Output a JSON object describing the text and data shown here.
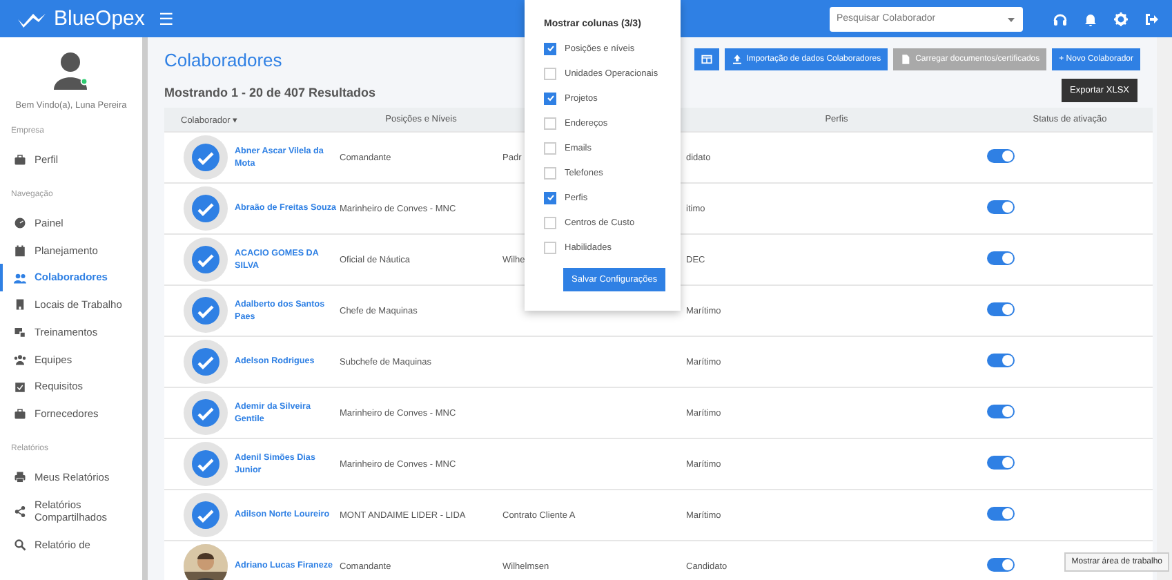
{
  "header": {
    "logo": "BlueOpex",
    "menu_glyph": "☰",
    "search": {
      "placeholder": "Pesquisar Colaborador"
    }
  },
  "sidebar": {
    "welcome": "Bem Vindo(a), Luna Pereira",
    "sections": [
      {
        "title": "Empresa",
        "items": [
          {
            "label": "Perfil",
            "selected": false
          }
        ]
      },
      {
        "title": "Navegação",
        "items": [
          {
            "label": "Painel",
            "selected": false
          },
          {
            "label": "Planejamento",
            "selected": false
          },
          {
            "label": "Colaboradores",
            "selected": true
          },
          {
            "label": "Locais de Trabalho",
            "selected": false
          },
          {
            "label": "Treinamentos",
            "selected": false
          },
          {
            "label": "Equipes",
            "selected": false
          },
          {
            "label": "Requisitos",
            "selected": false
          },
          {
            "label": "Fornecedores",
            "selected": false
          }
        ]
      },
      {
        "title": "Relatórios",
        "items": [
          {
            "label": "Meus Relatórios",
            "selected": false
          },
          {
            "label": "Relatórios Compartilhados",
            "selected": false
          },
          {
            "label": "Relatório de",
            "selected": false
          }
        ]
      }
    ]
  },
  "page": {
    "title": "Colaboradores",
    "results": "Mostrando 1 - 20 de 407 Resultados",
    "buttons": [
      {
        "kind": "icon",
        "disabled": false
      },
      {
        "kind": "upload",
        "label": "Importação de dados Colaboradores",
        "disabled": false
      },
      {
        "kind": "file",
        "label": "Carregar documentos/certificados",
        "disabled": true
      },
      {
        "kind": "plus",
        "label": "+ Novo Colaborador",
        "disabled": false
      }
    ],
    "tooltip": "Exportar XLSX"
  },
  "table": {
    "columns": [
      "Colaborador ▾",
      "Posições e Níveis",
      "",
      "Perfis",
      "Status de ativação"
    ],
    "rows": [
      {
        "kind": "badge",
        "name": "Abner Ascar Vilela da Mota",
        "position": "Comandante",
        "project": "Padr",
        "profile": "didato",
        "on": true
      },
      {
        "kind": "badge",
        "name": "Abraão de Freitas Souza",
        "position": "Marinheiro de Conves - MNC",
        "project": "",
        "profile": "itimo",
        "on": true
      },
      {
        "kind": "badge",
        "name": "ACACIO GOMES DA SILVA",
        "position": "Oficial de Náutica",
        "project": "Wilhe",
        "profile": "DEC",
        "on": true
      },
      {
        "kind": "badge",
        "name": "Adalberto dos Santos Paes",
        "position": "Chefe de Maquinas",
        "project": "",
        "profile": "Marítimo",
        "on": true
      },
      {
        "kind": "badge",
        "name": "Adelson Rodrigues",
        "position": "Subchefe de Maquinas",
        "project": "",
        "profile": "Marítimo",
        "on": true
      },
      {
        "kind": "badge",
        "name": "Ademir da Silveira Gentile",
        "position": "Marinheiro de Conves - MNC",
        "project": "",
        "profile": "Marítimo",
        "on": true
      },
      {
        "kind": "badge",
        "name": "Adenil Simões Dias Junior",
        "position": "Marinheiro de Conves - MNC",
        "project": "",
        "profile": "Marítimo",
        "on": true
      },
      {
        "kind": "badge",
        "name": "Adilson Norte Loureiro",
        "position": "MONT ANDAIME LIDER - LIDA",
        "project": "Contrato Cliente A",
        "profile": "Marítimo",
        "on": true
      },
      {
        "kind": "picture",
        "name": "Adriano Lucas Firaneze",
        "position": "Comandante",
        "project": "Wilhelmsen",
        "profile": "Candidato",
        "on": true
      }
    ]
  },
  "columns_popup": {
    "title": "Mostrar colunas (3/3)",
    "options": [
      {
        "label": "Posições e níveis",
        "checked": true
      },
      {
        "label": "Unidades Operacionais",
        "checked": false
      },
      {
        "label": "Projetos",
        "checked": true
      },
      {
        "label": "Endereços",
        "checked": false
      },
      {
        "label": "Emails",
        "checked": false
      },
      {
        "label": "Telefones",
        "checked": false
      },
      {
        "label": "Perfis",
        "checked": true
      },
      {
        "label": "Centros de Custo",
        "checked": false
      },
      {
        "label": "Habilidades",
        "checked": false
      }
    ],
    "save": "Salvar Configurações"
  },
  "taskbar_tooltip": "Mostrar área de trabalho"
}
